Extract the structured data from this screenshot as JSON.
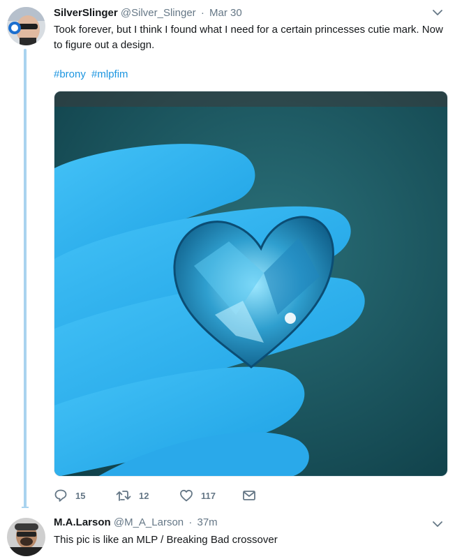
{
  "tweets": [
    {
      "name": "SilverSlinger",
      "handle": "@Silver_Slinger",
      "separator": "·",
      "time": "Mar 30",
      "text": "Took forever, but I think I found what I need for a certain princesses cutie mark. Now to figure out a design.",
      "hashtags": [
        "#brony",
        "#mlpfim"
      ],
      "actions": {
        "replies": "15",
        "retweets": "12",
        "likes": "117"
      }
    },
    {
      "name": "M.A.Larson",
      "handle": "@M_A_Larson",
      "separator": "·",
      "time": "37m",
      "text": "This pic is like an MLP / Breaking Bad crossover"
    }
  ],
  "icons": {
    "reply": "reply-icon",
    "retweet": "retweet-icon",
    "like": "heart-icon",
    "dm": "envelope-icon",
    "caret": "chevron-down-icon"
  },
  "colors": {
    "link": "#1b95e0",
    "secondary_text": "#657786",
    "thread_line": "#a9d3ef",
    "glove": "#2fb4f3",
    "gem": "#3aa8d8"
  }
}
